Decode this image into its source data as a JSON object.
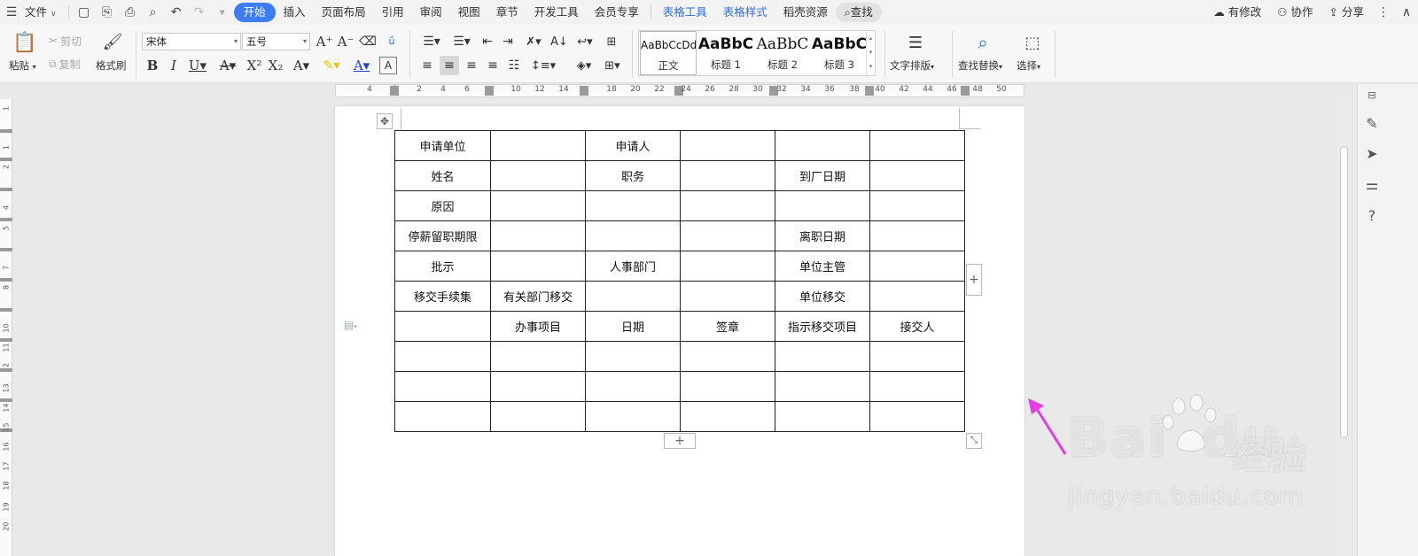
{
  "menubar": {
    "file": "文件",
    "tabs": [
      "开始",
      "插入",
      "页面布局",
      "引用",
      "审阅",
      "视图",
      "章节",
      "开发工具",
      "会员专享",
      "表格工具",
      "表格样式",
      "稻壳资源"
    ],
    "search": "查找",
    "modified": "有修改",
    "collab": "协作",
    "share": "分享",
    "accent": "#3d7df3"
  },
  "ribbon": {
    "paste": "粘贴",
    "cut": "剪切",
    "copy": "复制",
    "format_painter": "格式刷",
    "font_name": "宋体",
    "font_size": "五号",
    "text_layout": "文字排版",
    "find_replace": "查找替换",
    "select": "选择",
    "styles": [
      {
        "sample": "AaBbCcDd",
        "name": "正文"
      },
      {
        "sample": "AaBbC",
        "name": "标题 1"
      },
      {
        "sample": "AaBbC",
        "name": "标题 2"
      },
      {
        "sample": "AaBbC",
        "name": "标题 3"
      }
    ]
  },
  "ruler": {
    "h_ticks": [
      "4",
      "2",
      "2",
      "4",
      "6",
      "10",
      "12",
      "14",
      "18",
      "20",
      "22",
      "24",
      "26",
      "28",
      "30",
      "32",
      "34",
      "36",
      "38",
      "40",
      "42",
      "44",
      "46",
      "48",
      "50"
    ],
    "v_ticks": [
      "1",
      "1",
      "2",
      "4",
      "5",
      "7",
      "8",
      "10",
      "11",
      "2",
      "13",
      "14",
      "15",
      "16",
      "17",
      "18",
      "19",
      "20"
    ]
  },
  "table": {
    "rows": [
      [
        "申请单位",
        "",
        "申请人",
        "",
        "",
        ""
      ],
      [
        "姓名",
        "",
        "职务",
        "",
        "到厂日期",
        ""
      ],
      [
        "原因",
        "",
        "",
        "",
        "",
        ""
      ],
      [
        "停薪留职期限",
        "",
        "",
        "",
        "离职日期",
        ""
      ],
      [
        "批示",
        "",
        "人事部门",
        "",
        "单位主管",
        ""
      ],
      [
        "移交手续集",
        "有关部门移交",
        "",
        "",
        "单位移交",
        ""
      ],
      [
        "",
        "办事项目",
        "日期",
        "签章",
        "指示移交项目",
        "接交人"
      ],
      [
        "",
        "",
        "",
        "",
        "",
        ""
      ],
      [
        "",
        "",
        "",
        "",
        "",
        ""
      ],
      [
        "",
        "",
        "",
        "",
        "",
        ""
      ]
    ]
  },
  "watermark": {
    "logo": "Bai",
    "logo_tail": "du",
    "cn": "经验",
    "url": "jingyan.baidu.com"
  },
  "colors": {
    "arrow": "#e63ce6"
  }
}
